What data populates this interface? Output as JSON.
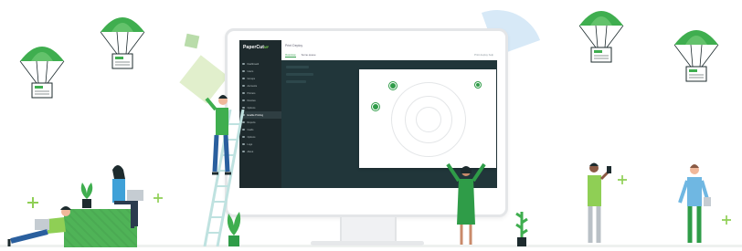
{
  "app": {
    "logo_text": "PaperCut",
    "logo_suffix": "MF",
    "page_title": "Print Deploy",
    "tabs": [
      "Overview",
      "Some queue"
    ],
    "top_right": "Print deploy help",
    "active_nav_index": 7
  },
  "nav_items": [
    {
      "label": "Dashboard",
      "icon": "dashboard-icon"
    },
    {
      "label": "Users",
      "icon": "users-icon"
    },
    {
      "label": "Groups",
      "icon": "groups-icon"
    },
    {
      "label": "Accounts",
      "icon": "accounts-icon"
    },
    {
      "label": "Printers",
      "icon": "printer-icon"
    },
    {
      "label": "Devices",
      "icon": "devices-icon"
    },
    {
      "label": "Options",
      "icon": "options-icon"
    },
    {
      "label": "Enable Printing",
      "icon": "print-icon"
    },
    {
      "label": "Reports",
      "icon": "reports-icon"
    },
    {
      "label": "Cards",
      "icon": "cards-icon"
    },
    {
      "label": "Options",
      "icon": "options-icon"
    },
    {
      "label": "Logs",
      "icon": "logs-icon"
    },
    {
      "label": "About",
      "icon": "about-icon"
    }
  ],
  "colors": {
    "brand_green": "#2f9c48",
    "parachute_green": "#3fae4f",
    "sidebar_dark": "#1e2a2d",
    "panel_dark": "#21363a",
    "accent_light_green": "#e1efcc",
    "accent_blue": "#d7e9f7"
  },
  "illustration": {
    "parachutes": 4,
    "people": 6,
    "plants": 4,
    "map_pins": 3,
    "icons": [
      "parachute-icon",
      "printer-icon",
      "map-pin-icon",
      "ladder-icon",
      "laptop-icon",
      "plant-icon",
      "sparkle-icon"
    ]
  }
}
